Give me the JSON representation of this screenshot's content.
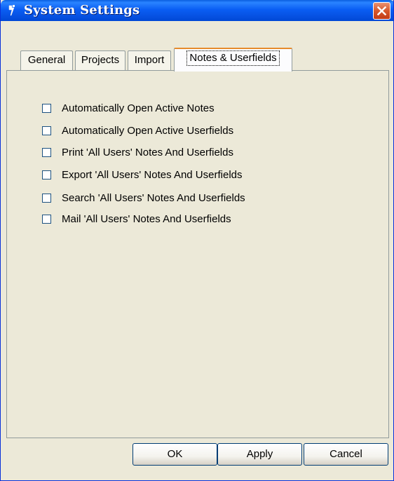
{
  "window": {
    "title": "System Settings",
    "title_icon": "app-icon",
    "close_icon": "close-icon"
  },
  "tabs": [
    {
      "label": "General",
      "active": false
    },
    {
      "label": "Projects",
      "active": false
    },
    {
      "label": "Import",
      "active": false
    },
    {
      "label": "Notes & Userfields",
      "active": true
    }
  ],
  "options": [
    {
      "label": "Automatically Open Active Notes",
      "checked": false
    },
    {
      "label": "Automatically Open Active Userfields",
      "checked": false
    },
    {
      "label": "Print 'All Users' Notes And Userfields",
      "checked": false
    },
    {
      "label": "Export 'All Users' Notes And Userfields",
      "checked": false
    },
    {
      "label": "Search 'All Users' Notes And Userfields",
      "checked": false
    },
    {
      "label": "Mail 'All Users' Notes And Userfields",
      "checked": false
    }
  ],
  "buttons": {
    "ok": "OK",
    "apply": "Apply",
    "cancel": "Cancel"
  },
  "colors": {
    "titlebar": "#0a5ef4",
    "dialog_background": "#ece9d8",
    "active_tab_accent": "#e68b2c",
    "close_button": "#d6582c"
  }
}
